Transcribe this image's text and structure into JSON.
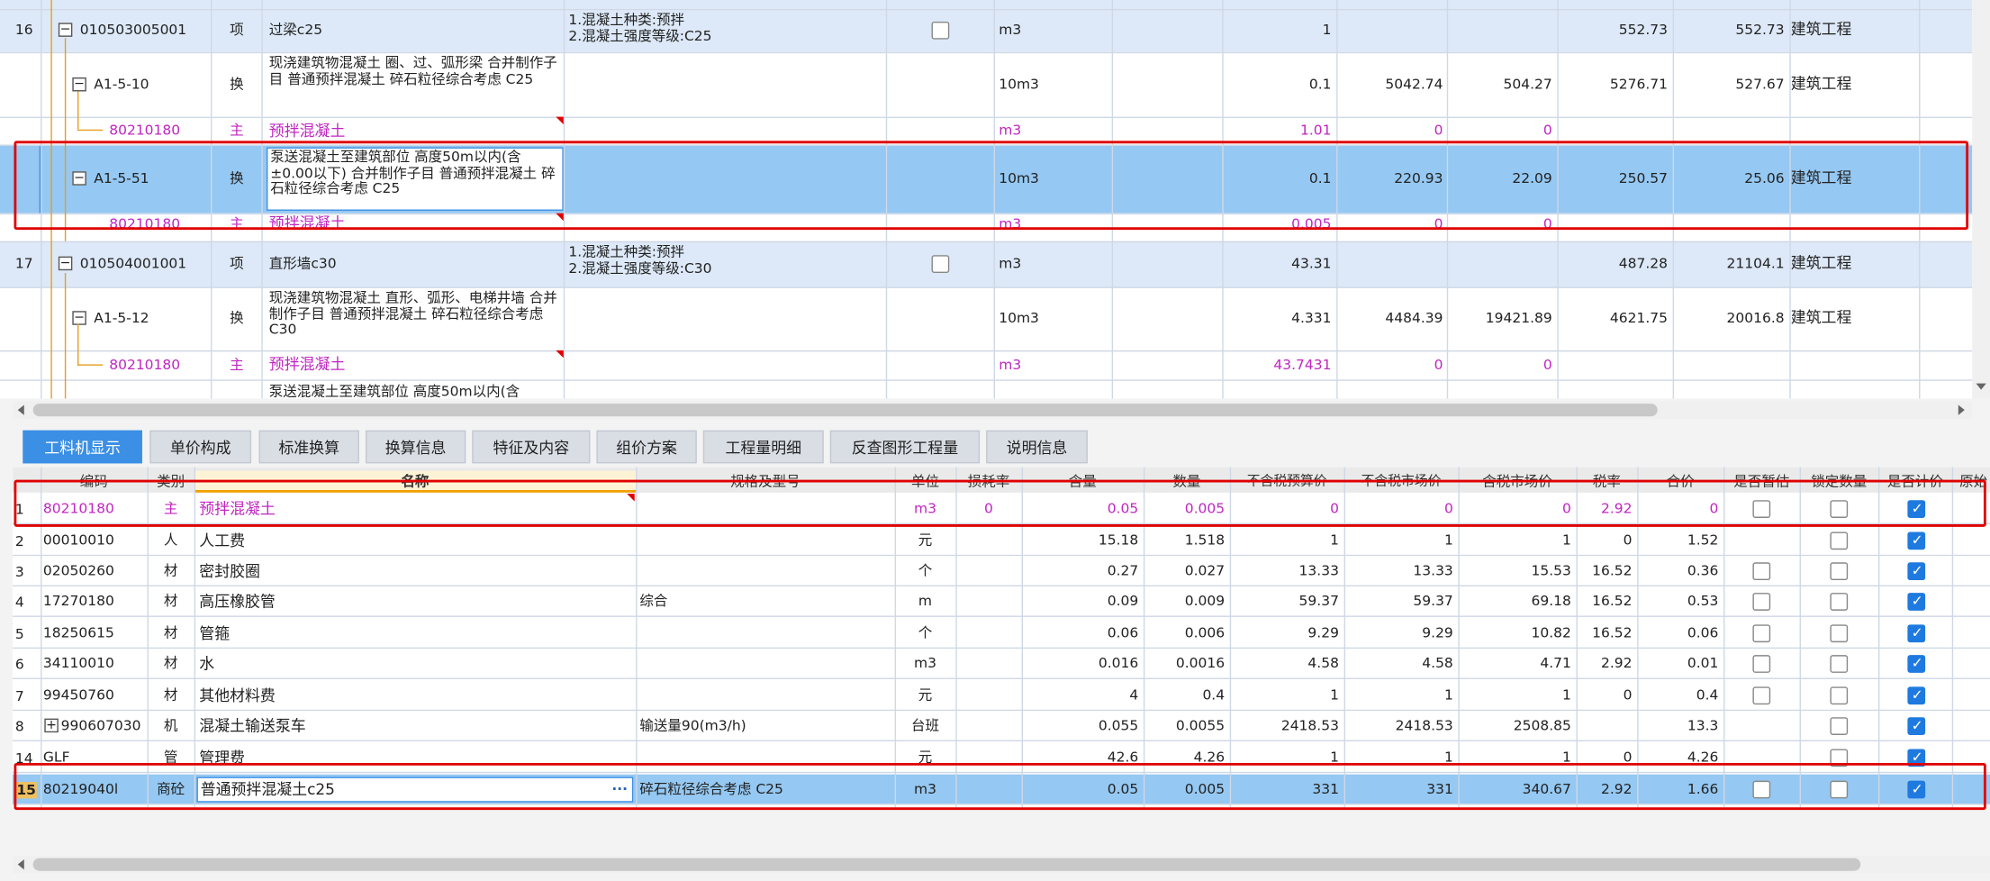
{
  "upper": {
    "rows": [
      {
        "idx": "16",
        "code": "010503005001",
        "kind": "项",
        "name": "过梁c25",
        "desc": "1.混凝土种类:预拌\n2.混凝土强度等级:C25",
        "unit": "m3",
        "qty": "1",
        "price": "552.73",
        "total": "552.73",
        "prof": "建筑工程"
      },
      {
        "code": "A1-5-10",
        "kind": "换",
        "name": "现浇建筑物混凝土 圈、过、弧形梁  合并制作子目 普通预拌混凝土 碎石粒径综合考虑 C25",
        "unit": "10m3",
        "qty": "0.1",
        "p1": "5042.74",
        "p2": "504.27",
        "price": "5276.71",
        "total": "527.67",
        "prof": "建筑工程"
      },
      {
        "code": "80210180",
        "kind": "主",
        "name": "预拌混凝土",
        "unit": "m3",
        "qty": "1.01",
        "p1": "0",
        "p2": "0"
      },
      {
        "code": "A1-5-51",
        "kind": "换",
        "name": "泵送混凝土至建筑部位 高度50m以内(含±0.00以下)  合并制作子目 普通预拌混凝土 碎石粒径综合考虑 C25",
        "unit": "10m3",
        "qty": "0.1",
        "p1": "220.93",
        "p2": "22.09",
        "price": "250.57",
        "total": "25.06",
        "prof": "建筑工程"
      },
      {
        "code": "80210180",
        "kind": "主",
        "name": "预拌混凝土",
        "unit": "m3",
        "qty": "0.005",
        "p1": "0",
        "p2": "0"
      },
      {
        "idx": "17",
        "code": "010504001001",
        "kind": "项",
        "name": "直形墙c30",
        "desc": "1.混凝土种类:预拌\n2.混凝土强度等级:C30",
        "unit": "m3",
        "qty": "43.31",
        "price": "487.28",
        "total": "21104.1",
        "prof": "建筑工程"
      },
      {
        "code": "A1-5-12",
        "kind": "换",
        "name": "现浇建筑物混凝土 直形、弧形、电梯井墙  合并制作子目 普通预拌混凝土 碎石粒径综合考虑 C30",
        "unit": "10m3",
        "qty": "4.331",
        "p1": "4484.39",
        "p2": "19421.89",
        "price": "4621.75",
        "total": "20016.8",
        "prof": "建筑工程"
      },
      {
        "code": "80210180",
        "kind": "主",
        "name": "预拌混凝土",
        "unit": "m3",
        "qty": "43.7431",
        "p1": "0",
        "p2": "0"
      },
      {
        "name": "泵送混凝土至建筑部位 高度50m以内(含"
      }
    ]
  },
  "tabs": [
    "工料机显示",
    "单价构成",
    "标准换算",
    "换算信息",
    "特征及内容",
    "组价方案",
    "工程量明细",
    "反查图形工程量",
    "说明信息"
  ],
  "headers": [
    "编码",
    "类别",
    "名称",
    "规格及型号",
    "单位",
    "损耗率",
    "含量",
    "数量",
    "不含税预算价",
    "不含税市场价",
    "含税市场价",
    "税率",
    "合价",
    "是否暂估",
    "锁定数量",
    "是否计价",
    "原始"
  ],
  "lower": {
    "rows": [
      {
        "n": "1",
        "code": "80210180",
        "kind": "主",
        "name": "预拌混凝土",
        "spec": "",
        "unit": "m3",
        "loss": "0",
        "content": "0.05",
        "qty": "0.005",
        "p1": "0",
        "p2": "0",
        "p3": "0",
        "tax": "2.92",
        "total": "0",
        "est": false,
        "lock": false,
        "price": true
      },
      {
        "n": "2",
        "code": "00010010",
        "kind": "人",
        "name": "人工费",
        "spec": "",
        "unit": "元",
        "loss": "",
        "content": "15.18",
        "qty": "1.518",
        "p1": "1",
        "p2": "1",
        "p3": "1",
        "tax": "0",
        "total": "1.52",
        "est": null,
        "lock": false,
        "price": true
      },
      {
        "n": "3",
        "code": "02050260",
        "kind": "材",
        "name": "密封胶圈",
        "spec": "",
        "unit": "个",
        "loss": "",
        "content": "0.27",
        "qty": "0.027",
        "p1": "13.33",
        "p2": "13.33",
        "p3": "15.53",
        "tax": "16.52",
        "total": "0.36",
        "est": false,
        "lock": false,
        "price": true
      },
      {
        "n": "4",
        "code": "17270180",
        "kind": "材",
        "name": "高压橡胶管",
        "spec": "综合",
        "unit": "m",
        "loss": "",
        "content": "0.09",
        "qty": "0.009",
        "p1": "59.37",
        "p2": "59.37",
        "p3": "69.18",
        "tax": "16.52",
        "total": "0.53",
        "est": false,
        "lock": false,
        "price": true
      },
      {
        "n": "5",
        "code": "18250615",
        "kind": "材",
        "name": "管箍",
        "spec": "",
        "unit": "个",
        "loss": "",
        "content": "0.06",
        "qty": "0.006",
        "p1": "9.29",
        "p2": "9.29",
        "p3": "10.82",
        "tax": "16.52",
        "total": "0.06",
        "est": false,
        "lock": false,
        "price": true
      },
      {
        "n": "6",
        "code": "34110010",
        "kind": "材",
        "name": "水",
        "spec": "",
        "unit": "m3",
        "loss": "",
        "content": "0.016",
        "qty": "0.0016",
        "p1": "4.58",
        "p2": "4.58",
        "p3": "4.71",
        "tax": "2.92",
        "total": "0.01",
        "est": false,
        "lock": false,
        "price": true
      },
      {
        "n": "7",
        "code": "99450760",
        "kind": "材",
        "name": "其他材料费",
        "spec": "",
        "unit": "元",
        "loss": "",
        "content": "4",
        "qty": "0.4",
        "p1": "1",
        "p2": "1",
        "p3": "1",
        "tax": "0",
        "total": "0.4",
        "est": false,
        "lock": false,
        "price": true
      },
      {
        "n": "8",
        "code": "990607030",
        "kind": "机",
        "name": "混凝土输送泵车",
        "spec": "输送量90(m3/h)",
        "unit": "台班",
        "loss": "",
        "content": "0.055",
        "qty": "0.0055",
        "p1": "2418.53",
        "p2": "2418.53",
        "p3": "2508.85",
        "tax": "",
        "total": "13.3",
        "est": null,
        "lock": false,
        "price": true
      },
      {
        "n": "14",
        "code": "GLF",
        "kind": "管",
        "name": "管理费",
        "spec": "",
        "unit": "元",
        "loss": "",
        "content": "42.6",
        "qty": "4.26",
        "p1": "1",
        "p2": "1",
        "p3": "1",
        "tax": "0",
        "total": "4.26",
        "est": null,
        "lock": false,
        "price": true
      },
      {
        "n": "15",
        "code": "80219040l",
        "kind": "商砼",
        "name": "普通预拌混凝土c25",
        "spec": "碎石粒径综合考虑 C25",
        "unit": "m3",
        "loss": "",
        "content": "0.05",
        "qty": "0.005",
        "p1": "331",
        "p2": "331",
        "p3": "340.67",
        "tax": "2.92",
        "total": "1.66",
        "est": false,
        "lock": false,
        "price": true
      }
    ],
    "ellipsis": "···"
  },
  "colors": {
    "accent": "#3b8fe4",
    "selected": "#95c8f2",
    "itemRow": "#dde9f8",
    "magenta": "#c026c0",
    "highlight": "#e00000"
  }
}
